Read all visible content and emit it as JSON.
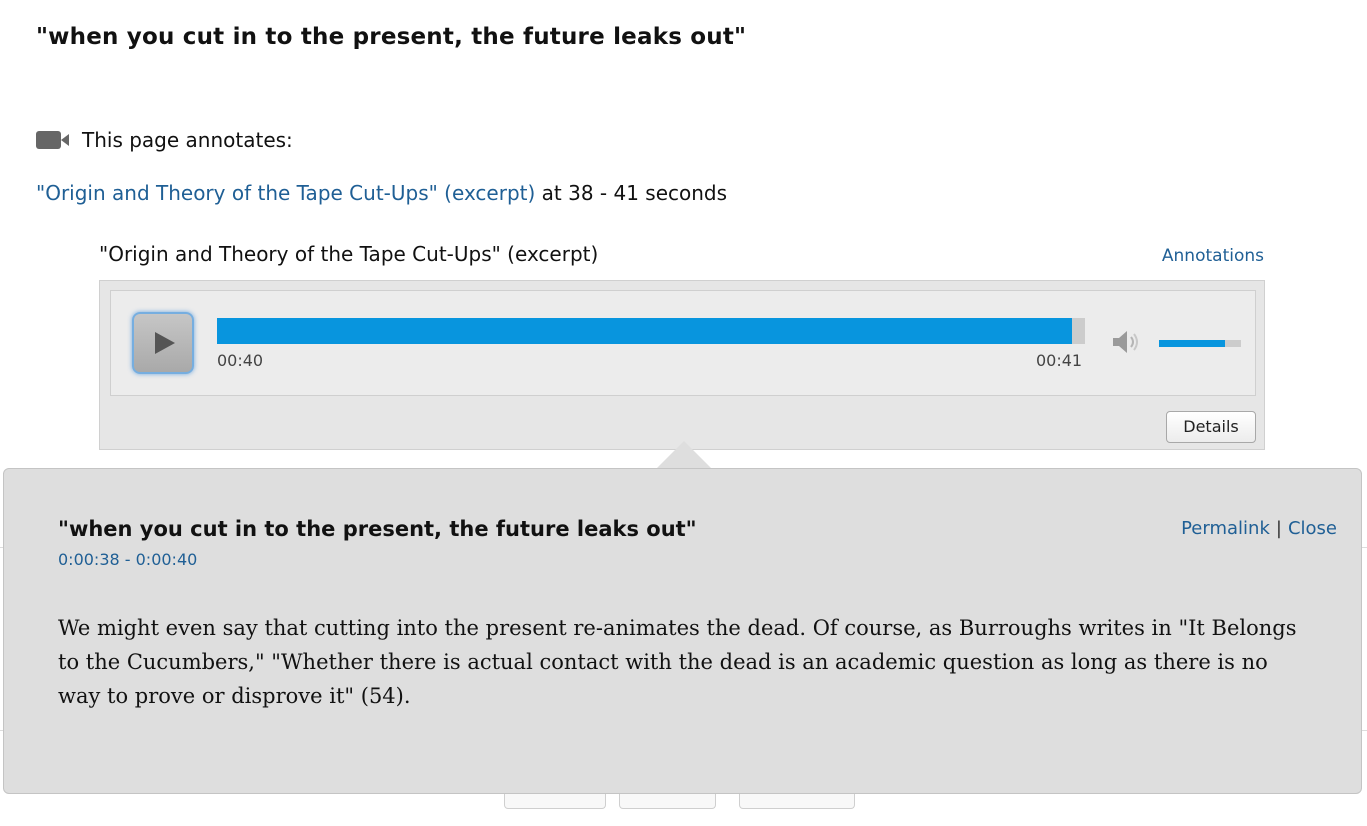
{
  "page": {
    "title": "\"when you cut in to the present, the future leaks out\"",
    "annotates_label": "This page annotates:",
    "source_link": "\"Origin and Theory of the Tape Cut-Ups\" (excerpt)",
    "source_suffix": " at 38 - 41 seconds"
  },
  "player": {
    "title": "\"Origin and Theory of the Tape Cut-Ups\" (excerpt)",
    "annotations_label": "Annotations",
    "current_time": "00:40",
    "end_time": "00:41",
    "progress_percent": 98.5,
    "volume_percent": 80,
    "details_label": "Details",
    "icons": {
      "play": "play-icon",
      "volume": "volume-icon",
      "camera": "video-camera-icon"
    }
  },
  "popup": {
    "title": "\"when you cut in to the present, the future leaks out\"",
    "range": "0:00:38 - 0:00:40",
    "permalink_label": "Permalink",
    "separator": "|",
    "close_label": "Close",
    "body": "We might even say that cutting into the present re-animates the dead. Of course, as Burroughs writes in \"It Belongs to the Cucumbers,\" \"Whether there is actual contact with the dead is an academic question as long as there is no way to prove or disprove it\" (54)."
  },
  "colors": {
    "link": "#1f5f95",
    "progress": "#0895de",
    "popup_bg": "#dedede"
  }
}
